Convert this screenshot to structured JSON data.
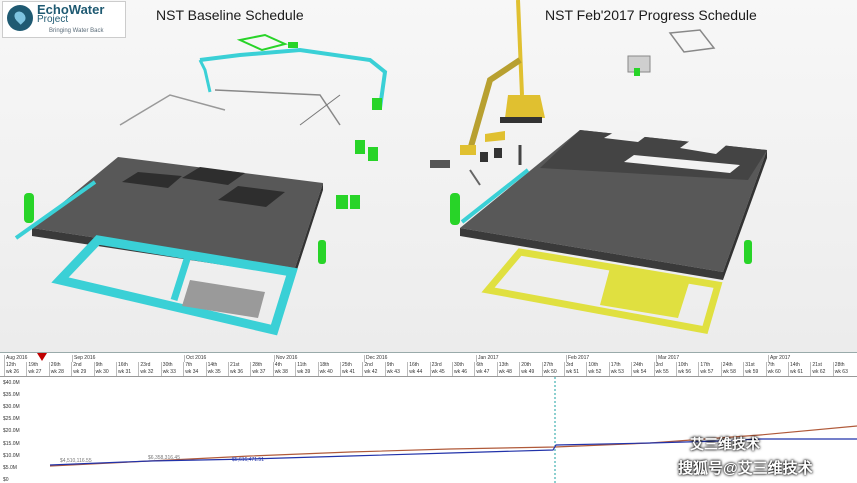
{
  "logo": {
    "name": "EchoWater",
    "sub": "Project",
    "tagline": "Bringing Water Back"
  },
  "titles": {
    "left": "NST Baseline Schedule",
    "right": "NST Feb'2017 Progress Schedule"
  },
  "colors": {
    "cyan": "#3ad0d6",
    "green": "#28d428",
    "yellow": "#e0e040",
    "slab": "#505050",
    "planned": "#b05a3a",
    "actual": "#2233aa"
  },
  "gantt": {
    "months": [
      "Aug 2016",
      "Sep 2016",
      "Oct 2016",
      "Nov 2016",
      "Dec 2016",
      "Jan 2017",
      "Feb 2017",
      "Mar 2017",
      "Apr 2017"
    ],
    "days": [
      "12th",
      "19th",
      "26th",
      "2nd",
      "9th",
      "16th",
      "23rd",
      "30th",
      "7th",
      "14th",
      "21st",
      "28th",
      "4th",
      "11th",
      "18th",
      "25th",
      "2nd",
      "9th",
      "16th",
      "23rd",
      "30th",
      "6th",
      "13th",
      "20th",
      "27th",
      "3rd",
      "10th",
      "17th",
      "24th",
      "3rd",
      "10th",
      "17th",
      "24th",
      "31st",
      "7th",
      "14th",
      "21st",
      "28th"
    ],
    "weeks": [
      "wk 26",
      "wk 27",
      "wk 28",
      "wk 29",
      "wk 30",
      "wk 31",
      "wk 32",
      "wk 33",
      "wk 34",
      "wk 35",
      "wk 36",
      "wk 37",
      "wk 38",
      "wk 39",
      "wk 40",
      "wk 41",
      "wk 42",
      "wk 43",
      "wk 44",
      "wk 45",
      "wk 46",
      "wk 47",
      "wk 48",
      "wk 49",
      "wk 50",
      "wk 51",
      "wk 52",
      "wk 53",
      "wk 54",
      "wk 55",
      "wk 56",
      "wk 57",
      "wk 58",
      "wk 59",
      "wk 60",
      "wk 61",
      "wk 62",
      "wk 63"
    ],
    "y_axis": [
      "$40.0M",
      "$35.0M",
      "$30.0M",
      "$25.0M",
      "$20.0M",
      "$15.0M",
      "$10.0M",
      "$5.0M",
      "$0"
    ],
    "cost_labels": [
      "$4,510,116.55",
      "$6,358,316.45",
      "$5,616,471.51"
    ]
  },
  "watermark": {
    "line1": "艾三维技术",
    "line2": "搜狐号@艾三维技术"
  }
}
